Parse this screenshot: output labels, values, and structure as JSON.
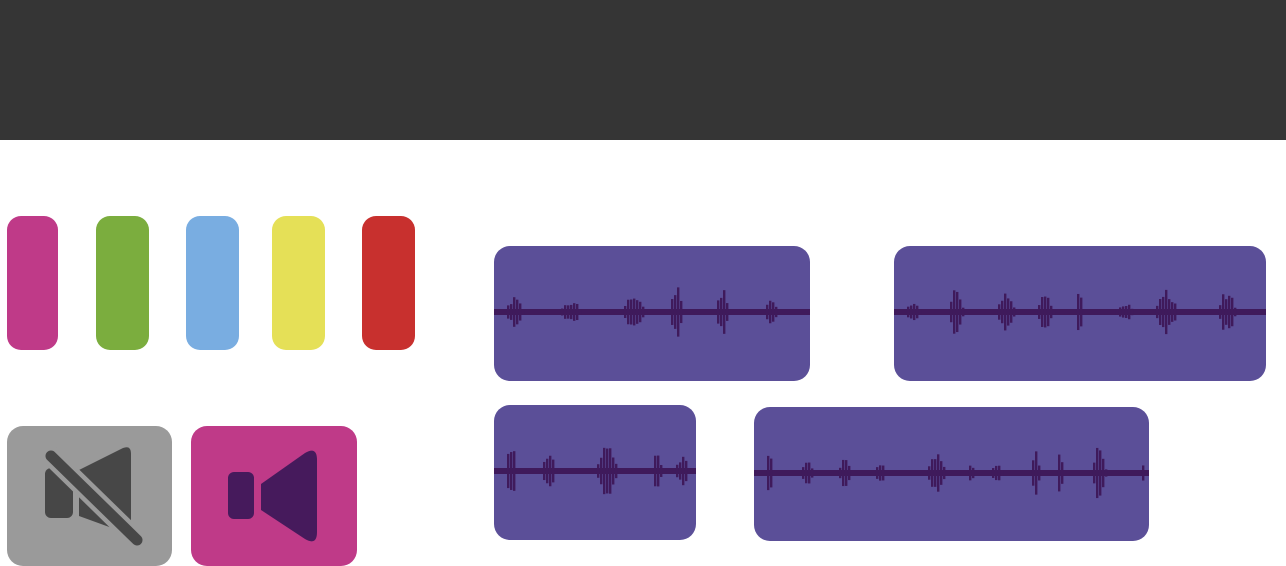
{
  "colors": {
    "header": "#353535",
    "background": "#ffffff",
    "clip_fill": "#5b4f98",
    "waveform": "#3f1a5b",
    "mute_bg": "#9a9a9a",
    "mute_icon": "#474747",
    "unmute_bg": "#bf3a88",
    "unmute_icon": "#461a5c"
  },
  "track_colors": [
    {
      "name": "magenta",
      "hex": "#bf3a88"
    },
    {
      "name": "green",
      "hex": "#7bad3e"
    },
    {
      "name": "blue",
      "hex": "#79ade1"
    },
    {
      "name": "yellow",
      "hex": "#e5e057"
    },
    {
      "name": "red",
      "hex": "#c8302e"
    }
  ],
  "audio_controls": {
    "mute_icon": "speaker-muted-icon",
    "unmute_icon": "speaker-icon"
  },
  "clips": [
    {
      "name": "audio-clip-1"
    },
    {
      "name": "audio-clip-2"
    },
    {
      "name": "audio-clip-3"
    },
    {
      "name": "audio-clip-4"
    }
  ]
}
